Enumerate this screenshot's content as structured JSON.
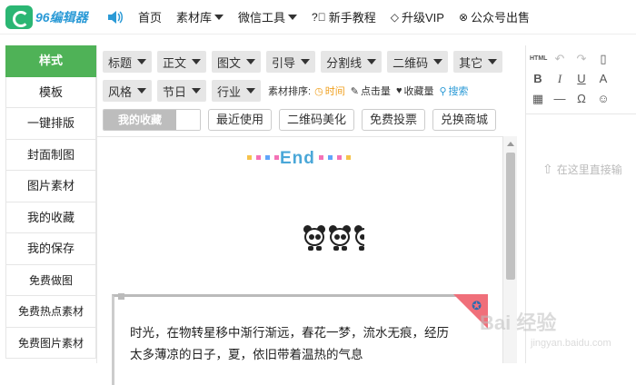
{
  "logo": {
    "text": "96编辑器"
  },
  "nav": {
    "items": [
      {
        "label": "首页",
        "caret": false
      },
      {
        "label": "素材库",
        "caret": true
      },
      {
        "label": "微信工具",
        "caret": true
      }
    ],
    "tutorial": "新手教程",
    "vip": "升级VIP",
    "sell": "公众号出售"
  },
  "sidebar": {
    "items": [
      "样式",
      "模板",
      "一键排版",
      "封面制图",
      "图片素材",
      "我的收藏",
      "我的保存",
      "免费做图",
      "免费热点素材",
      "免费图片素材"
    ]
  },
  "filters": {
    "row1": [
      "标题",
      "正文",
      "图文",
      "引导",
      "分割线",
      "二维码",
      "其它"
    ],
    "row2": [
      "风格",
      "节日",
      "行业"
    ],
    "sort_label": "素材排序:",
    "sort": {
      "time": "时间",
      "clicks": "点击量",
      "favs": "收藏量",
      "search": "搜索"
    }
  },
  "buttons": {
    "my_fav": "我的收藏",
    "recent": "最近使用",
    "qr": "二维码美化",
    "vote": "免费投票",
    "shop": "兑换商城"
  },
  "preview": {
    "end_text": "End",
    "paragraph": "时光，在物转星移中渐行渐远，春花一梦，流水无痕，经历太多薄凉的日子，夏，依旧带着温热的气息"
  },
  "editor": {
    "html_label": "HTML",
    "drop_hint": "在这里直接输"
  },
  "watermark": {
    "main": "Bai 经验",
    "sub": "jingyan.baidu.com"
  },
  "colors": {
    "accent": "#4fb257",
    "link": "#2b9ad6",
    "corner": "#f06f7a"
  }
}
